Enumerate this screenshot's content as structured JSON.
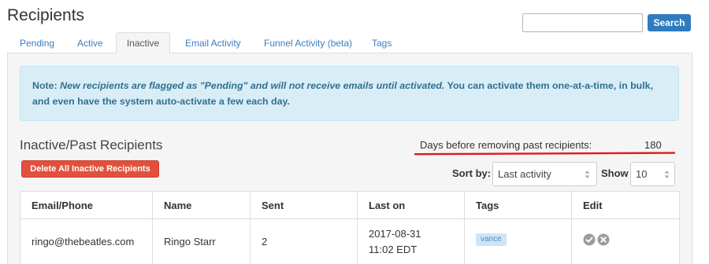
{
  "page": {
    "title": "Recipients"
  },
  "search": {
    "button_label": "Search"
  },
  "tabs": [
    {
      "label": "Pending",
      "active": false
    },
    {
      "label": "Active",
      "active": false
    },
    {
      "label": "Inactive",
      "active": true
    },
    {
      "label": "Email Activity",
      "active": false
    },
    {
      "label": "Funnel Activity (beta)",
      "active": false
    },
    {
      "label": "Tags",
      "active": false
    }
  ],
  "alert": {
    "note_label": "Note:",
    "emphasis": "New recipients are flagged as \"Pending\" and will not receive emails until activated.",
    "body": "You can activate them one-at-a-time, in bulk, and even have the system auto-activate a few each day."
  },
  "inactive_section": {
    "title": "Inactive/Past Recipients",
    "days_label": "Days before removing past recipients:",
    "days_value": "180",
    "delete_button_label": "Delete All Inactive Recipients"
  },
  "list_controls": {
    "sort_label": "Sort by:",
    "sort_value": "Last activity",
    "show_label": "Show",
    "show_value": "10"
  },
  "table": {
    "columns": [
      "Email/Phone",
      "Name",
      "Sent",
      "Last on",
      "Tags",
      "Edit"
    ],
    "rows": [
      {
        "email": "ringo@thebeatles.com",
        "name": "Ringo Starr",
        "sent": "2",
        "last_on_date": "2017-08-31",
        "last_on_time": "11:02 EDT",
        "tags": [
          "vance"
        ],
        "edit_icons": [
          "check-circle-icon",
          "close-circle-icon"
        ]
      }
    ]
  },
  "colors": {
    "primary": "#2f7bc0",
    "tab_link": "#3a7fc1",
    "danger": "#e2503d",
    "alert_bg": "#d9edf7",
    "alert_border": "#bce8f1",
    "alert_text": "#31708f",
    "tag_bg": "#cde5f6",
    "tag_text": "#4a8fcd",
    "icon_gray": "#9b9b9b",
    "annotation": "#e3161b"
  }
}
